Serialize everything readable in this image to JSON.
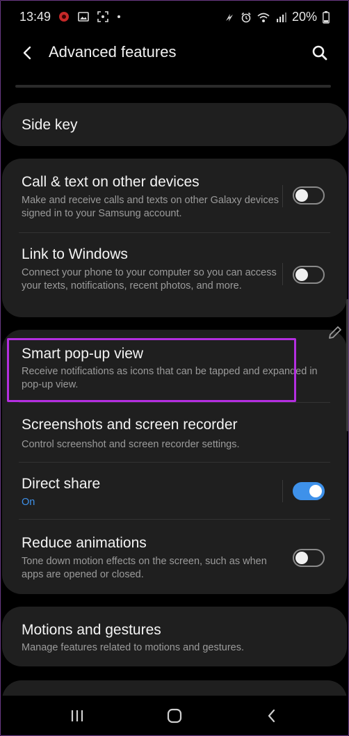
{
  "status_bar": {
    "time": "13:49",
    "battery": "20%",
    "left_icons": [
      "notification-app-icon",
      "gallery-icon",
      "screenshot-icon",
      "dot-icon"
    ],
    "right_icons": [
      "nfc-icon",
      "alarm-icon",
      "wifi-icon",
      "signal-icon",
      "battery-icon"
    ]
  },
  "header": {
    "title": "Advanced features",
    "back_icon": "chevron-left-icon",
    "search_icon": "search-icon"
  },
  "side_key": {
    "title": "Side key"
  },
  "connectivity": {
    "call_text": {
      "title": "Call & text on other devices",
      "desc": "Make and receive calls and texts on other Galaxy devices signed in to your Samsung account.",
      "enabled": false
    },
    "link_windows": {
      "title": "Link to Windows",
      "desc": "Connect your phone to your computer so you can access your texts, notifications, recent photos, and more.",
      "enabled": false
    }
  },
  "features": {
    "smart_popup": {
      "title": "Smart pop-up view",
      "desc": "Receive notifications as icons that can be tapped and expanded in pop-up view."
    },
    "screenshots": {
      "title": "Screenshots and screen recorder",
      "desc": "Control screenshot and screen recorder settings."
    },
    "direct_share": {
      "title": "Direct share",
      "status": "On",
      "enabled": true
    },
    "reduce_animations": {
      "title": "Reduce animations",
      "desc": "Tone down motion effects on the screen, such as when apps are opened or closed.",
      "enabled": false
    }
  },
  "motions": {
    "title": "Motions and gestures",
    "desc": "Manage features related to motions and gestures."
  },
  "colors": {
    "accent": "#3e91ea",
    "highlight": "#b42ee0",
    "card": "#1f1f1f",
    "background": "#000000"
  },
  "nav_bar": {
    "icons": [
      "recents-icon",
      "home-icon",
      "back-icon"
    ]
  }
}
